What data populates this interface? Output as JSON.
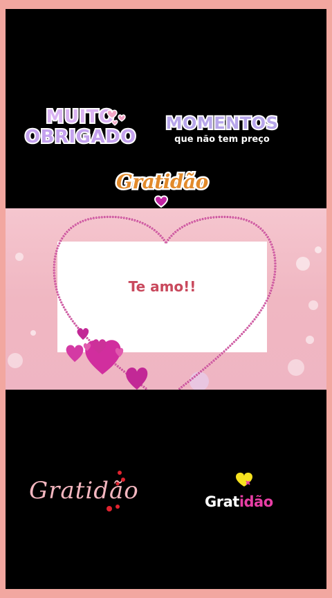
{
  "stickers": {
    "muito_obrigado": {
      "line1": "MUITO",
      "line2": "OBRIGADO"
    },
    "momentos": {
      "title": "MOMENTOS",
      "subtitle": "que não tem preço"
    },
    "gratidao_top": "Gratidão",
    "gratidao_script": "Gratidão",
    "gratidao_bold": {
      "part1": "Grat",
      "part2": "idão"
    }
  },
  "card": {
    "message": "Te amo!!"
  },
  "colors": {
    "page_border": "#f2a7a0",
    "background": "#000000",
    "panel_pink": "#f5c6cf",
    "heart_outline": "#b3327f",
    "hearts_magenta": "#d12e9e",
    "message_red": "#c9495d"
  }
}
